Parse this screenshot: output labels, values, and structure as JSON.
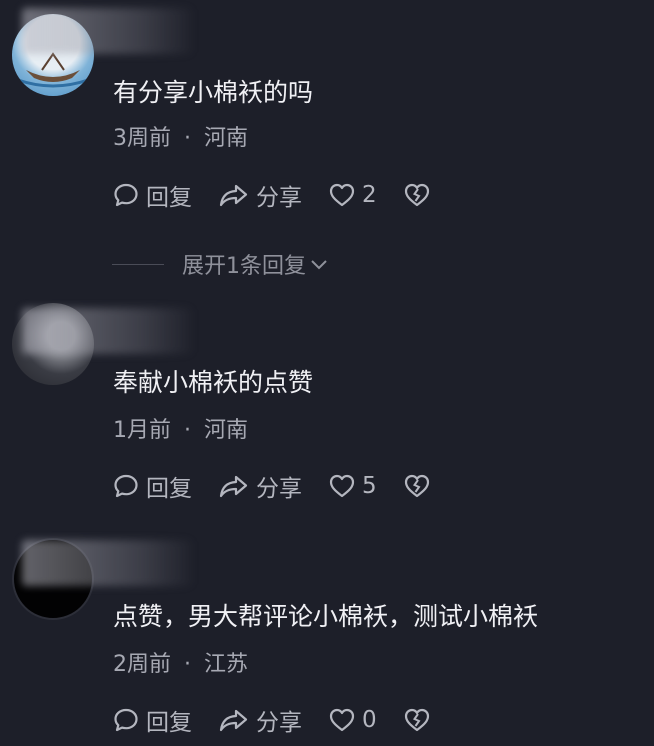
{
  "comments": [
    {
      "text": "有分享小棉袄的吗",
      "time": "3周前",
      "sep": "·",
      "location": "河南",
      "reply_label": "回复",
      "share_label": "分享",
      "likes": "2",
      "expand_label": "展开1条回复"
    },
    {
      "text": "奉献小棉袄的点赞",
      "time": "1月前",
      "sep": "·",
      "location": "河南",
      "reply_label": "回复",
      "share_label": "分享",
      "likes": "5"
    },
    {
      "text": "点赞，男大帮评论小棉袄，测试小棉袄",
      "time": "2周前",
      "sep": "·",
      "location": "江苏",
      "reply_label": "回复",
      "share_label": "分享",
      "likes": "0"
    }
  ],
  "icons": [
    "comment-bubble-icon",
    "share-arrow-icon",
    "heart-icon",
    "broken-heart-icon",
    "chevron-down-icon"
  ]
}
